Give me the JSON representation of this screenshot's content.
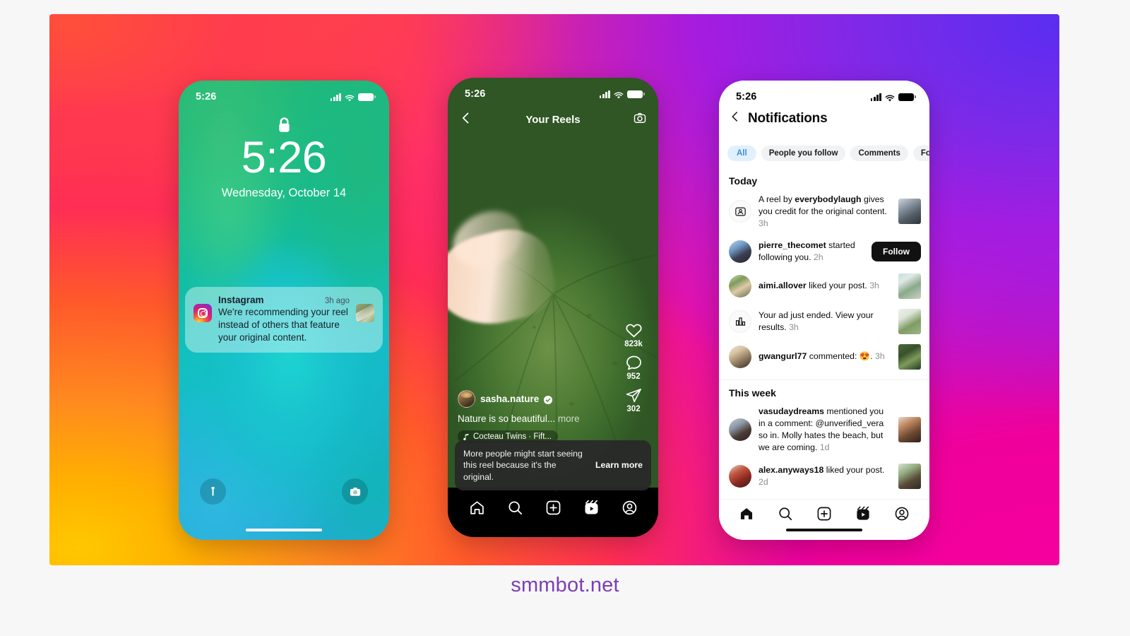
{
  "footer": {
    "brand": "smmbot.net",
    "brand_color": "#7b3fb5"
  },
  "background": {
    "colors": [
      "#ffc800",
      "#ff6a1a",
      "#ff2d6f",
      "#f0119e",
      "#b61ddb",
      "#6a2bf2"
    ]
  },
  "lockscreen": {
    "status": {
      "time": "5:26",
      "signal_icon": "cellular-signal-icon",
      "wifi_icon": "wifi-icon",
      "battery_icon": "battery-icon"
    },
    "lock_icon": "lock-icon",
    "clock": "5:26",
    "date": "Wednesday, October 14",
    "notification": {
      "app_icon": "instagram-app-icon",
      "app": "Instagram",
      "time": "3h ago",
      "text": "We're recommending your reel instead of others that feature your original content.",
      "thumbnail": "reel-thumbnail"
    },
    "flashlight_icon": "flashlight-icon",
    "camera_icon": "camera-icon",
    "home_indicator": "home-indicator"
  },
  "reels": {
    "status": {
      "time": "5:26",
      "signal_icon": "cellular-signal-icon",
      "wifi_icon": "wifi-icon",
      "battery_icon": "battery-icon"
    },
    "back_icon": "chevron-left-icon",
    "title": "Your Reels",
    "camera_icon": "camera-icon",
    "actions": [
      {
        "icon": "heart-icon",
        "count": "823k"
      },
      {
        "icon": "comment-icon",
        "count": "952"
      },
      {
        "icon": "share-icon",
        "count": "302"
      }
    ],
    "more_icon": "more-options-icon",
    "caption": {
      "avatar": "user-avatar",
      "username": "sasha.nature",
      "verified_icon": "verified-badge-icon",
      "text": "Nature is so beautiful...",
      "more_label": "more",
      "music_icon": "music-note-icon",
      "music": "Cocteau Twins · Fift..."
    },
    "banner": {
      "text": "More people might start seeing this reel because it's the original.",
      "link": "Learn more"
    },
    "nav": [
      {
        "icon": "home-icon",
        "name": "home"
      },
      {
        "icon": "search-icon",
        "name": "search"
      },
      {
        "icon": "create-icon",
        "name": "create"
      },
      {
        "icon": "reels-icon",
        "name": "reels"
      },
      {
        "icon": "profile-icon",
        "name": "profile"
      }
    ],
    "home_indicator": "home-indicator"
  },
  "notifications": {
    "status": {
      "time": "5:26",
      "signal_icon": "cellular-signal-icon",
      "wifi_icon": "wifi-icon",
      "battery_icon": "battery-icon"
    },
    "back_icon": "chevron-left-icon",
    "title": "Notifications",
    "filters": [
      {
        "label": "All",
        "active": true
      },
      {
        "label": "People you follow",
        "active": false
      },
      {
        "label": "Comments",
        "active": false
      },
      {
        "label": "Follows",
        "active": false
      }
    ],
    "sections": [
      {
        "heading": "Today",
        "items": [
          {
            "avatar_type": "icon",
            "avatar_icon": "reel-credit-icon",
            "text_prefix": "A reel by ",
            "text_bold": "everybodylaugh",
            "text_suffix": " gives you credit for the original content.",
            "time": "3h",
            "thumbnail": "post-thumbnail",
            "thumb_class": "th-a"
          },
          {
            "avatar_type": "photo",
            "avatar_class": "av-a",
            "text_prefix": "",
            "text_bold": "pierre_thecomet",
            "text_suffix": " started following you.",
            "time": "2h",
            "action_label": "Follow"
          },
          {
            "avatar_type": "photo",
            "avatar_class": "av-b",
            "text_prefix": "",
            "text_bold": "aimi.allover",
            "text_suffix": " liked your post.",
            "time": "3h",
            "thumbnail": "post-thumbnail",
            "thumb_class": "th-b"
          },
          {
            "avatar_type": "icon",
            "avatar_icon": "bar-chart-icon",
            "text_prefix": "",
            "text_bold": "",
            "text_suffix": "Your ad just ended. View your results.",
            "time": "3h",
            "thumbnail": "post-thumbnail",
            "thumb_class": "th-c"
          },
          {
            "avatar_type": "photo",
            "avatar_class": "av-c",
            "text_prefix": "",
            "text_bold": "gwangurl77",
            "text_suffix": " commented: 😍.",
            "time": "3h",
            "thumbnail": "post-thumbnail",
            "thumb_class": "th-d"
          }
        ]
      },
      {
        "heading": "This week",
        "items": [
          {
            "avatar_type": "photo",
            "avatar_class": "av-d",
            "text_prefix": "",
            "text_bold": "vasudaydreams",
            "text_suffix": " mentioned you in a comment: @unverified_vera so in. Molly hates the beach, but we are coming.",
            "time": "1d",
            "thumbnail": "post-thumbnail",
            "thumb_class": "th-e"
          },
          {
            "avatar_type": "photo",
            "avatar_class": "av-e",
            "text_prefix": "",
            "text_bold": "alex.anyways18",
            "text_suffix": " liked your post.",
            "time": "2d",
            "thumbnail": "post-thumbnail",
            "thumb_class": "th-f"
          }
        ]
      }
    ],
    "nav": [
      {
        "icon": "home-icon",
        "name": "home"
      },
      {
        "icon": "search-icon",
        "name": "search"
      },
      {
        "icon": "create-icon",
        "name": "create"
      },
      {
        "icon": "reels-icon",
        "name": "reels"
      },
      {
        "icon": "profile-icon",
        "name": "profile"
      }
    ],
    "home_indicator": "home-indicator"
  }
}
